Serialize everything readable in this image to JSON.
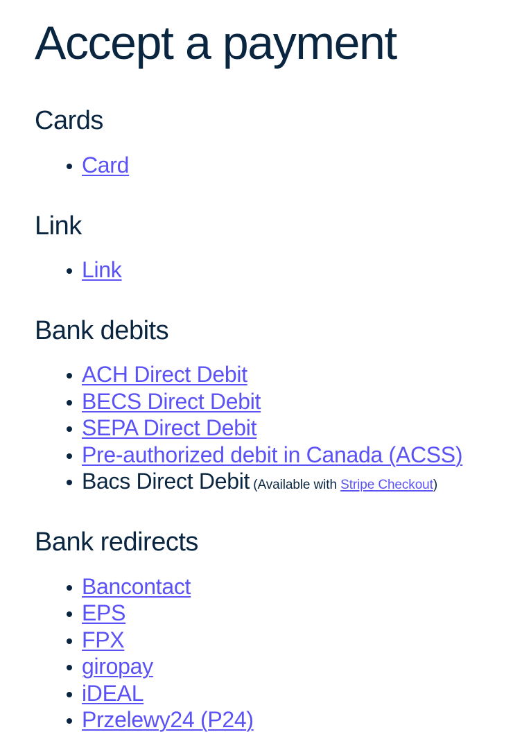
{
  "page": {
    "title": "Accept a payment"
  },
  "sections": [
    {
      "id": "cards",
      "heading": "Cards",
      "items": [
        {
          "label": "Card",
          "is_link": true
        }
      ]
    },
    {
      "id": "link",
      "heading": "Link",
      "items": [
        {
          "label": "Link",
          "is_link": true
        }
      ]
    },
    {
      "id": "bank-debits",
      "heading": "Bank debits",
      "items": [
        {
          "label": "ACH Direct Debit",
          "is_link": true
        },
        {
          "label": "BECS Direct Debit",
          "is_link": true
        },
        {
          "label": "SEPA Direct Debit",
          "is_link": true
        },
        {
          "label": "Pre-authorized debit in Canada (ACSS)",
          "is_link": true
        },
        {
          "label": "Bacs Direct Debit",
          "is_link": false,
          "note_prefix": "(Available with ",
          "note_link": "Stripe Checkout",
          "note_suffix": ")"
        }
      ]
    },
    {
      "id": "bank-redirects",
      "heading": "Bank redirects",
      "items": [
        {
          "label": "Bancontact",
          "is_link": true
        },
        {
          "label": "EPS",
          "is_link": true
        },
        {
          "label": "FPX",
          "is_link": true
        },
        {
          "label": "giropay",
          "is_link": true
        },
        {
          "label": "iDEAL",
          "is_link": true
        },
        {
          "label": "Przelewy24 (P24)",
          "is_link": true
        }
      ]
    }
  ],
  "colors": {
    "text": "#0a2540",
    "link": "#5b52f5",
    "background": "#ffffff"
  }
}
